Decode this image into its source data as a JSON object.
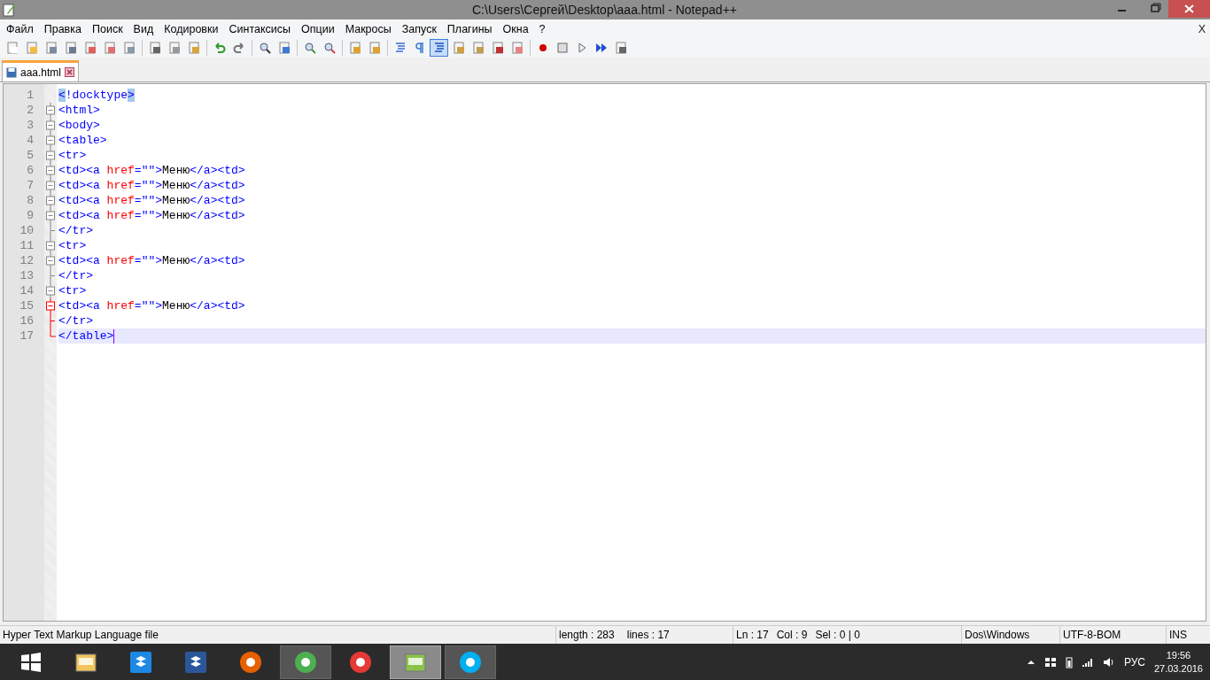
{
  "window": {
    "title": "C:\\Users\\Сергей\\Desktop\\aaa.html - Notepad++"
  },
  "menu": [
    "Файл",
    "Правка",
    "Поиск",
    "Вид",
    "Кодировки",
    "Синтаксисы",
    "Опции",
    "Макросы",
    "Запуск",
    "Плагины",
    "Окна",
    "?"
  ],
  "menu_close": "X",
  "toolbar": [
    {
      "kind": "new",
      "selected": false
    },
    {
      "kind": "open",
      "selected": false
    },
    {
      "kind": "save",
      "selected": false
    },
    {
      "kind": "save-all",
      "selected": false
    },
    {
      "kind": "close",
      "selected": false
    },
    {
      "kind": "close-all",
      "selected": false
    },
    {
      "kind": "print",
      "selected": false
    },
    {
      "kind": "sep"
    },
    {
      "kind": "cut",
      "selected": false
    },
    {
      "kind": "copy",
      "selected": false
    },
    {
      "kind": "paste",
      "selected": false
    },
    {
      "kind": "sep"
    },
    {
      "kind": "undo",
      "selected": false
    },
    {
      "kind": "redo",
      "selected": false
    },
    {
      "kind": "sep"
    },
    {
      "kind": "find",
      "selected": false
    },
    {
      "kind": "replace",
      "selected": false
    },
    {
      "kind": "sep"
    },
    {
      "kind": "zoom-in",
      "selected": false
    },
    {
      "kind": "zoom-out",
      "selected": false
    },
    {
      "kind": "sep"
    },
    {
      "kind": "sync",
      "selected": false
    },
    {
      "kind": "sync",
      "selected": false
    },
    {
      "kind": "sep"
    },
    {
      "kind": "wrap",
      "selected": false
    },
    {
      "kind": "pilcrow",
      "selected": false
    },
    {
      "kind": "indent",
      "selected": true
    },
    {
      "kind": "lang",
      "selected": false
    },
    {
      "kind": "map",
      "selected": false
    },
    {
      "kind": "func",
      "selected": false
    },
    {
      "kind": "folder",
      "selected": false
    },
    {
      "kind": "sep"
    },
    {
      "kind": "record",
      "selected": false
    },
    {
      "kind": "stop",
      "selected": false
    },
    {
      "kind": "play",
      "selected": false
    },
    {
      "kind": "play-multi",
      "selected": false
    },
    {
      "kind": "save-macro",
      "selected": false
    }
  ],
  "tabs": [
    {
      "label": "aaa.html",
      "selected": true
    }
  ],
  "editor": {
    "lines": [
      {
        "number": "1",
        "current": false,
        "tokens": [
          {
            "kind": "tag",
            "text": "<",
            "match": true
          },
          {
            "kind": "tag",
            "text": "!docktype",
            "match": false
          },
          {
            "kind": "tag",
            "text": ">",
            "match": true
          }
        ]
      },
      {
        "number": "2",
        "fold_marker": {
          "kind": "open",
          "active": false
        },
        "current": false,
        "tokens": [
          {
            "kind": "tag",
            "text": "<html>",
            "match": false
          }
        ]
      },
      {
        "number": "3",
        "fold_marker": {
          "kind": "open",
          "active": false
        },
        "current": false,
        "tokens": [
          {
            "kind": "tag",
            "text": "<body>",
            "match": false
          }
        ]
      },
      {
        "number": "4",
        "fold_marker": {
          "kind": "open",
          "active": false
        },
        "current": false,
        "tokens": [
          {
            "kind": "tag",
            "text": "<table>",
            "match": false
          }
        ]
      },
      {
        "number": "5",
        "fold_marker": {
          "kind": "open",
          "active": false
        },
        "current": false,
        "tokens": [
          {
            "kind": "tag",
            "text": "<tr>",
            "match": false
          }
        ]
      },
      {
        "number": "6",
        "fold_marker": {
          "kind": "open",
          "active": false
        },
        "current": false,
        "tokens": [
          {
            "kind": "tag",
            "text": "<td><a ",
            "match": false
          },
          {
            "kind": "attr",
            "text": "href",
            "match": false
          },
          {
            "kind": "tag",
            "text": "=\"\">",
            "match": false
          },
          {
            "kind": "text",
            "text": "Меню",
            "match": false
          },
          {
            "kind": "tag",
            "text": "</a><td>",
            "match": false
          }
        ]
      },
      {
        "number": "7",
        "fold_marker": {
          "kind": "open",
          "active": false
        },
        "current": false,
        "tokens": [
          {
            "kind": "tag",
            "text": "<td><a ",
            "match": false
          },
          {
            "kind": "attr",
            "text": "href",
            "match": false
          },
          {
            "kind": "tag",
            "text": "=\"\">",
            "match": false
          },
          {
            "kind": "text",
            "text": "Меню",
            "match": false
          },
          {
            "kind": "tag",
            "text": "</a><td>",
            "match": false
          }
        ]
      },
      {
        "number": "8",
        "fold_marker": {
          "kind": "open",
          "active": false
        },
        "current": false,
        "tokens": [
          {
            "kind": "tag",
            "text": "<td><a ",
            "match": false
          },
          {
            "kind": "attr",
            "text": "href",
            "match": false
          },
          {
            "kind": "tag",
            "text": "=\"\">",
            "match": false
          },
          {
            "kind": "text",
            "text": "Меню",
            "match": false
          },
          {
            "kind": "tag",
            "text": "</a><td>",
            "match": false
          }
        ]
      },
      {
        "number": "9",
        "fold_marker": {
          "kind": "open",
          "active": false
        },
        "current": false,
        "tokens": [
          {
            "kind": "tag",
            "text": "<td><a ",
            "match": false
          },
          {
            "kind": "attr",
            "text": "href",
            "match": false
          },
          {
            "kind": "tag",
            "text": "=\"\">",
            "match": false
          },
          {
            "kind": "text",
            "text": "Меню",
            "match": false
          },
          {
            "kind": "tag",
            "text": "</a><td>",
            "match": false
          }
        ]
      },
      {
        "number": "10",
        "fold_marker": {
          "kind": "line",
          "active": false
        },
        "current": false,
        "tokens": [
          {
            "kind": "tag",
            "text": "</tr>",
            "match": false
          }
        ]
      },
      {
        "number": "11",
        "fold_marker": {
          "kind": "open",
          "active": false
        },
        "current": false,
        "tokens": [
          {
            "kind": "tag",
            "text": "<tr>",
            "match": false
          }
        ]
      },
      {
        "number": "12",
        "fold_marker": {
          "kind": "open",
          "active": false
        },
        "current": false,
        "tokens": [
          {
            "kind": "tag",
            "text": "<td><a ",
            "match": false
          },
          {
            "kind": "attr",
            "text": "href",
            "match": false
          },
          {
            "kind": "tag",
            "text": "=\"\">",
            "match": false
          },
          {
            "kind": "text",
            "text": "Меню",
            "match": false
          },
          {
            "kind": "tag",
            "text": "</a><td>",
            "match": false
          }
        ]
      },
      {
        "number": "13",
        "fold_marker": {
          "kind": "line",
          "active": false
        },
        "current": false,
        "tokens": [
          {
            "kind": "tag",
            "text": "</tr>",
            "match": false
          }
        ]
      },
      {
        "number": "14",
        "fold_marker": {
          "kind": "open",
          "active": false
        },
        "current": false,
        "tokens": [
          {
            "kind": "tag",
            "text": "<tr>",
            "match": false
          }
        ]
      },
      {
        "number": "15",
        "fold_marker": {
          "kind": "open",
          "active": true
        },
        "current": false,
        "tokens": [
          {
            "kind": "tag",
            "text": "<td><a ",
            "match": false
          },
          {
            "kind": "attr",
            "text": "href",
            "match": false
          },
          {
            "kind": "tag",
            "text": "=\"\">",
            "match": false
          },
          {
            "kind": "text",
            "text": "Меню",
            "match": false
          },
          {
            "kind": "tag",
            "text": "</a><td>",
            "match": false
          }
        ]
      },
      {
        "number": "16",
        "fold_marker": {
          "kind": "line",
          "active": true
        },
        "current": false,
        "tokens": [
          {
            "kind": "tag",
            "text": "</tr>",
            "match": false
          }
        ]
      },
      {
        "number": "17",
        "fold_marker": {
          "kind": "end",
          "active": true
        },
        "current": true,
        "tokens": [
          {
            "kind": "tag",
            "text": "</table>",
            "match": false
          }
        ]
      }
    ]
  },
  "status_bar": {
    "file_type": "Hyper Text Markup Language file",
    "length": "length : 283",
    "lines": "lines : 17",
    "ln": "Ln : 17",
    "col": "Col : 9",
    "sel": "Sel : 0 | 0",
    "eol": "Dos\\Windows",
    "encoding": "UTF-8-BOM",
    "mode": "INS"
  },
  "taskbar": {
    "apps": [
      {
        "kind": "start",
        "open": false,
        "selected": false
      },
      {
        "kind": "folder",
        "open": false,
        "selected": false
      },
      {
        "kind": "box",
        "open": false,
        "selected": false
      },
      {
        "kind": "word",
        "open": false,
        "selected": false
      },
      {
        "kind": "fox",
        "open": false,
        "selected": false
      },
      {
        "kind": "wheel",
        "open": true,
        "selected": false
      },
      {
        "kind": "y",
        "open": false,
        "selected": false
      },
      {
        "kind": "notepad",
        "open": true,
        "selected": true
      },
      {
        "kind": "s",
        "open": true,
        "selected": false
      }
    ],
    "language": "РУС",
    "time": "19:56",
    "date": "27.03.2016"
  }
}
